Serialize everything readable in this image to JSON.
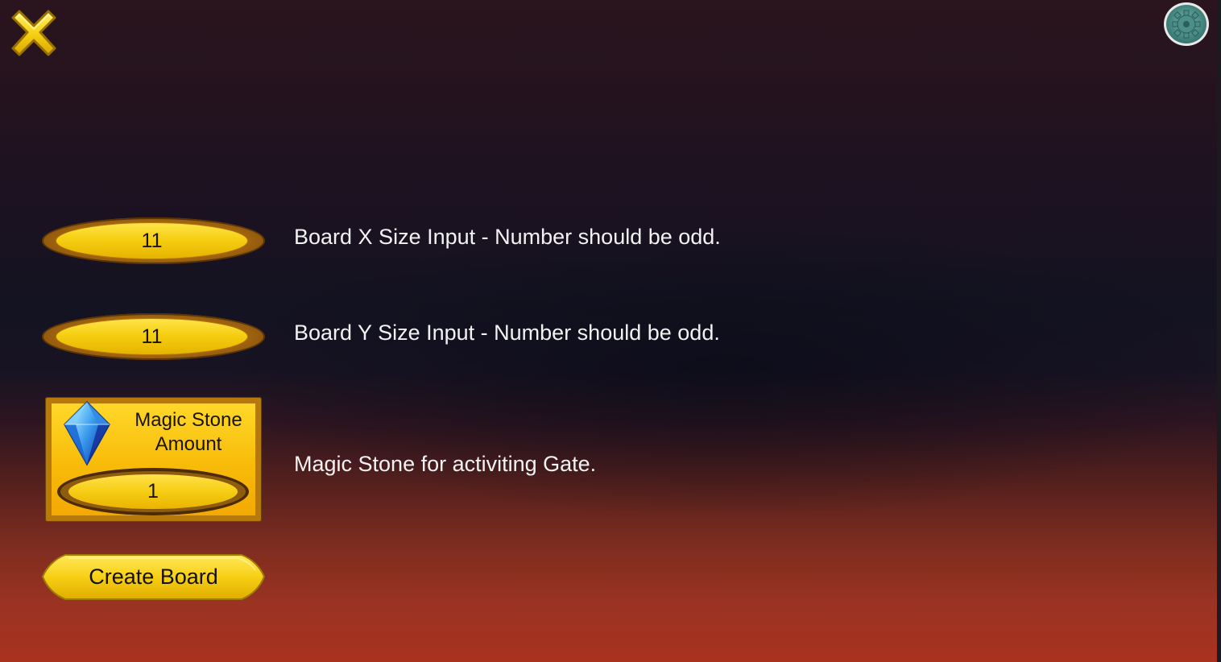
{
  "toolbar": {
    "close_icon": "close-x-icon",
    "settings_icon": "gear-icon"
  },
  "board_x": {
    "value": "11",
    "description": "Board X Size Input - Number should be odd."
  },
  "board_y": {
    "value": "11",
    "description": "Board Y Size Input - Number should be odd."
  },
  "magic_stone": {
    "title_line1": "Magic Stone",
    "title_line2": "Amount",
    "value": "1",
    "description": "Magic Stone for activiting Gate.",
    "icon": "crystal-gem-icon"
  },
  "create_button": {
    "label": "Create Board"
  },
  "colors": {
    "gold": "#f6cf12",
    "gold_dark": "#a0630f",
    "text_light": "#f2f2f2",
    "bg_top": "#2a141d",
    "bg_bottom": "#a9321f"
  }
}
